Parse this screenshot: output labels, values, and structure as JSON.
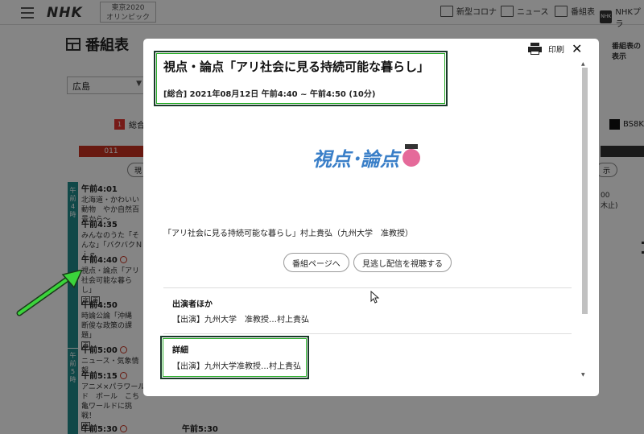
{
  "header": {
    "logo": "NHK",
    "olympic_line1": "東京2020",
    "olympic_line2": "オリンピック",
    "nav": [
      {
        "label": "新型コロナ",
        "icon": "news-grid-icon"
      },
      {
        "label": "ニュース",
        "icon": "news-icon"
      },
      {
        "label": "番組表",
        "icon": "schedule-icon"
      },
      {
        "label": "NHKプラ",
        "icon": "nhk-plus-icon"
      }
    ]
  },
  "page": {
    "title": "番組表",
    "region": "広島",
    "channel_badge": "1",
    "channel_name": "総合",
    "channel_number": "011",
    "bs8k": "BS8K",
    "pill_left": "現",
    "pill_right": "示",
    "right_top": "番組表の表示",
    "right_cell_1": "00",
    "right_cell_2": "木止)"
  },
  "timeline": {
    "hour4": "午前4時",
    "hour5": "午前5時"
  },
  "programs": [
    {
      "time": "午前4:01",
      "text": "北海道・かわいい動物　やか自然百景から～"
    },
    {
      "time": "午前4:35",
      "text": "みんなのうた「そんな」「バクバクＮｉｇ"
    },
    {
      "time": "午前4:40",
      "text": "視点・論点「アリ社会可能な暮らし」",
      "tags": [
        "字",
        "再"
      ]
    },
    {
      "time": "午前4:50",
      "text": "時論公論「沖縄　断俊な政策の課題」",
      "tags": [
        "再"
      ]
    },
    {
      "time": "午前5:00",
      "text": "ニュース・気象情報"
    },
    {
      "time": "午前5:15",
      "text": "アニメ×パラワールド　ボール　こち亀ワールドに挑戦！",
      "tags": [
        "字"
      ]
    },
    {
      "time": "午前5:30",
      "text": ""
    }
  ],
  "second_col_time": "午前5:30",
  "modal": {
    "title": "視点・論点「アリ社会に見る持続可能な暮らし」",
    "date": "[総合] 2021年08月12日 午前4:40 ~ 午前4:50 (10分)",
    "print_label": "印刷",
    "close_label": "✕",
    "image_logo": "視点･論点",
    "description": "「アリ社会に見る持続可能な暮らし」村上貴弘（九州大学　准教授）",
    "btn_program_page": "番組ページへ",
    "btn_watch": "見逃し配信を視聴する",
    "cast_heading": "出演者ほか",
    "cast_value": "【出演】九州大学　准教授…村上貴弘",
    "detail_heading": "詳細",
    "detail_value": "【出演】九州大学准教授…村上貴弘"
  },
  "colors": {
    "teal": "#1f8a8a",
    "red": "#c8311f",
    "highlight_green": "#27ae27",
    "arrow_green": "#3bd43b"
  }
}
